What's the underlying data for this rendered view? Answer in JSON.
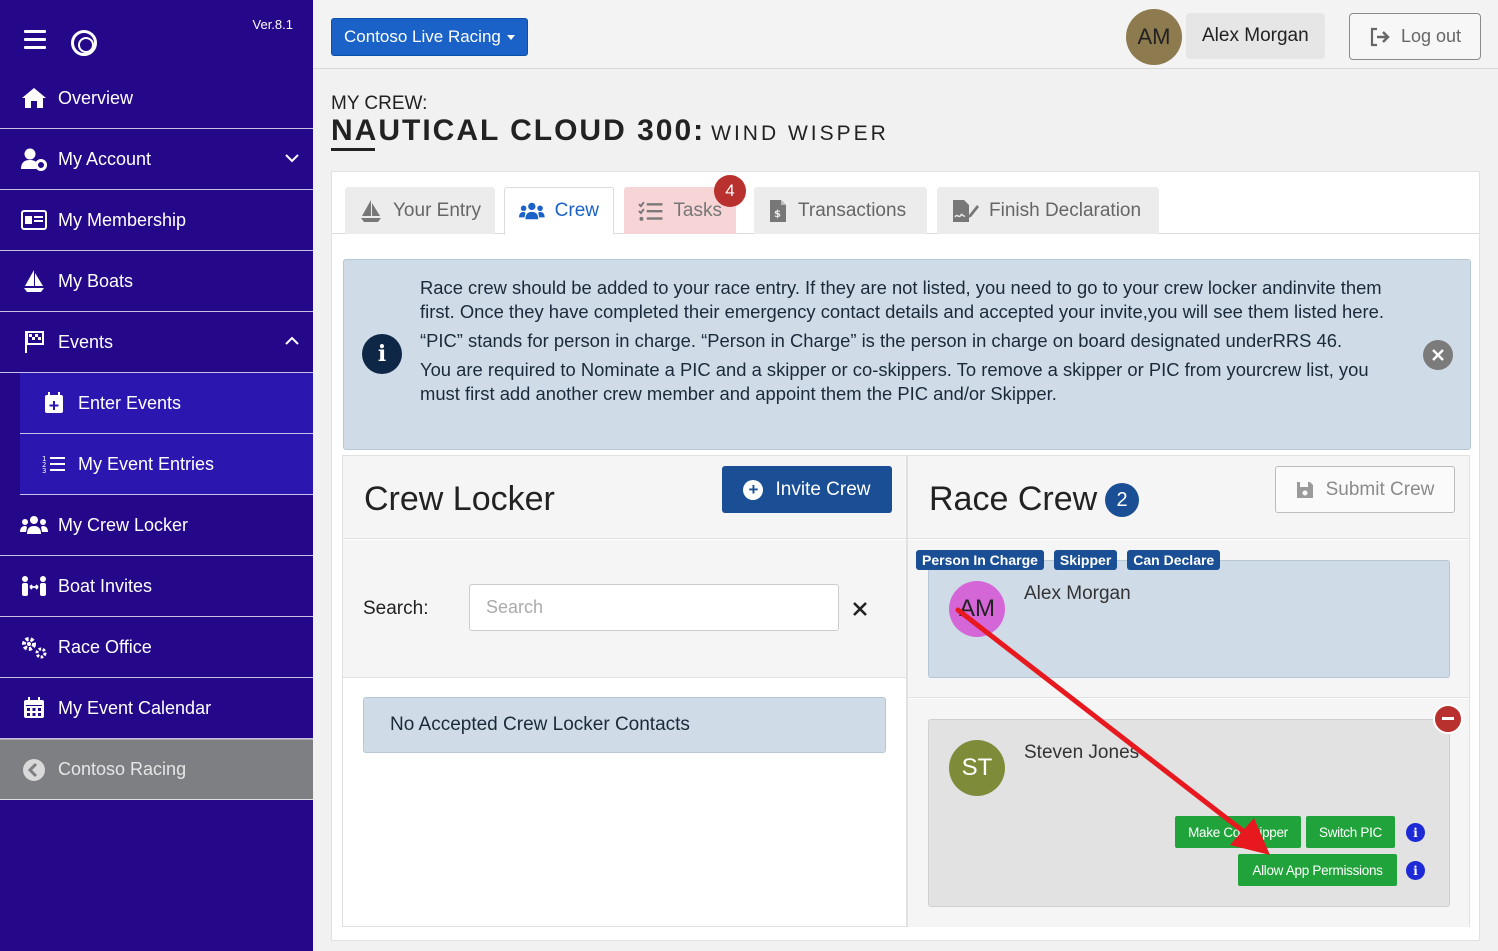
{
  "sidebar": {
    "version": "Ver.8.1",
    "items": [
      {
        "label": "Overview",
        "icon": "home-icon"
      },
      {
        "label": "My Account",
        "icon": "user-gear-icon"
      },
      {
        "label": "My Membership",
        "icon": "id-card-icon"
      },
      {
        "label": "My Boats",
        "icon": "sailboat-icon"
      },
      {
        "label": "Events",
        "icon": "flag-icon"
      },
      {
        "label": "Enter Events",
        "icon": "calendar-plus-icon"
      },
      {
        "label": "My Event Entries",
        "icon": "list-ordered-icon"
      },
      {
        "label": "My Crew Locker",
        "icon": "users-icon"
      },
      {
        "label": "Boat Invites",
        "icon": "people-arrows-icon"
      },
      {
        "label": "Race Office",
        "icon": "gears-icon"
      },
      {
        "label": "My Event Calendar",
        "icon": "calendar-icon"
      },
      {
        "label": "Contoso Racing",
        "icon": "chevron-left-circle-icon"
      }
    ]
  },
  "topbar": {
    "site": "Contoso Live Racing",
    "avatar_initials": "AM",
    "user_name": "Alex Morgan",
    "logout": "Log out"
  },
  "heading": {
    "label": "MY CREW:",
    "boat": "NAUTICAL CLOUD 300:",
    "boat_name": "WIND WISPER"
  },
  "tabs": [
    {
      "label": "Your Entry"
    },
    {
      "label": "Crew"
    },
    {
      "label": "Tasks",
      "badge": "4"
    },
    {
      "label": "Transactions"
    },
    {
      "label": "Finish Declaration"
    }
  ],
  "alert": {
    "p1": "Race crew should be added to your race entry. If they are not listed, you need to go to your crew locker andinvite them first. Once they have completed their emergency contact details and accepted your invite,you will see them listed here.",
    "p2": "“PIC” stands for person in charge. “Person in Charge” is the person in charge on board designated underRRS 46.",
    "p3": "You are required to Nominate a PIC and a skipper or co-skippers. To remove a skipper or PIC from yourcrew list, you must first add another crew member and appoint them the PIC and/or Skipper."
  },
  "locker": {
    "title": "Crew Locker",
    "invite": "Invite Crew",
    "search_label": "Search:",
    "search_placeholder": "Search",
    "empty": "No Accepted Crew Locker Contacts"
  },
  "race_crew": {
    "title": "Race Crew",
    "count": "2",
    "submit": "Submit Crew",
    "members": [
      {
        "initials": "AM",
        "name": "Alex Morgan",
        "roles": [
          "Person In Charge",
          "Skipper",
          "Can Declare"
        ],
        "avatar_color": "#d566d8"
      },
      {
        "initials": "ST",
        "name": "Steven Jones",
        "avatar_color": "#7e8c3a",
        "buttons": {
          "co_skipper": "Make Co-Skipper",
          "switch_pic": "Switch PIC",
          "permissions": "Allow App Permissions"
        }
      }
    ]
  },
  "colors": {
    "sidebar": "#25078a",
    "primary": "#1a4f95",
    "success": "#21a33b",
    "danger": "#b9312e",
    "annotation_arrow": "#e8191e"
  }
}
